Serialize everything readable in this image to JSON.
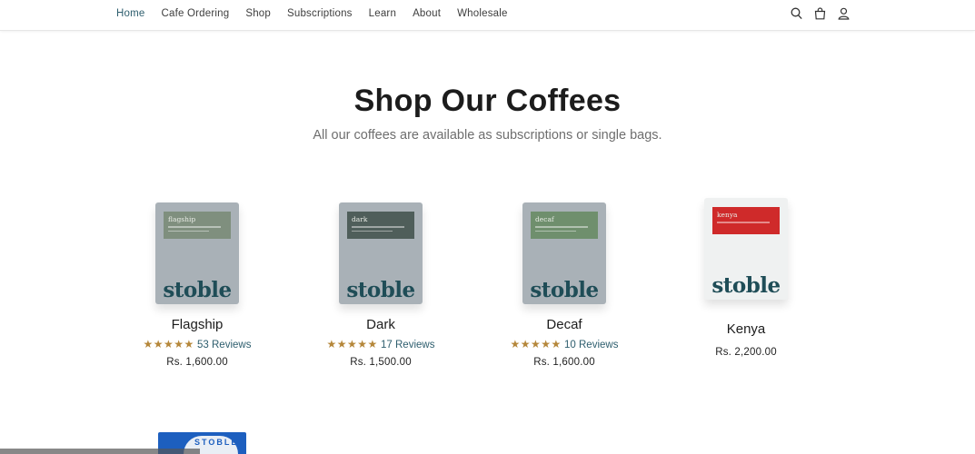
{
  "nav": {
    "items": [
      {
        "label": "Home",
        "active": true
      },
      {
        "label": "Cafe Ordering",
        "active": false
      },
      {
        "label": "Shop",
        "active": false
      },
      {
        "label": "Subscriptions",
        "active": false
      },
      {
        "label": "Learn",
        "active": false
      },
      {
        "label": "About",
        "active": false
      },
      {
        "label": "Wholesale",
        "active": false
      }
    ],
    "icons": [
      "search-icon",
      "cart-icon",
      "account-icon"
    ]
  },
  "hero": {
    "title": "Shop Our Coffees",
    "subtitle": "All our coffees are available as subscriptions or single bags."
  },
  "products": [
    {
      "name": "Flagship",
      "bag_label": "flagship",
      "brand": "stoble",
      "stars": "★★★★★",
      "reviews": "53 Reviews",
      "price": "Rs. 1,600.00",
      "bag_color": "#a9b1b7",
      "label_color": "#7f8f7e"
    },
    {
      "name": "Dark",
      "bag_label": "dark",
      "brand": "stoble",
      "stars": "★★★★★",
      "reviews": "17 Reviews",
      "price": "Rs. 1,500.00",
      "bag_color": "#a9b1b7",
      "label_color": "#4f5e5a"
    },
    {
      "name": "Decaf",
      "bag_label": "decaf",
      "brand": "stoble",
      "stars": "★★★★★",
      "reviews": "10 Reviews",
      "price": "Rs. 1,600.00",
      "bag_color": "#a9b1b7",
      "label_color": "#6f8f6d"
    },
    {
      "name": "Kenya",
      "bag_label": "kenya",
      "brand": "stoble",
      "stars": "",
      "reviews": "",
      "price": "Rs. 2,200.00",
      "bag_color": "#eff1f1",
      "label_color": "#cf2a2a"
    }
  ],
  "partial": {
    "text": "STOBLE"
  },
  "colors": {
    "accent": "#2e5e6e",
    "star": "#b5873a",
    "brand_text": "#1f4d57"
  }
}
